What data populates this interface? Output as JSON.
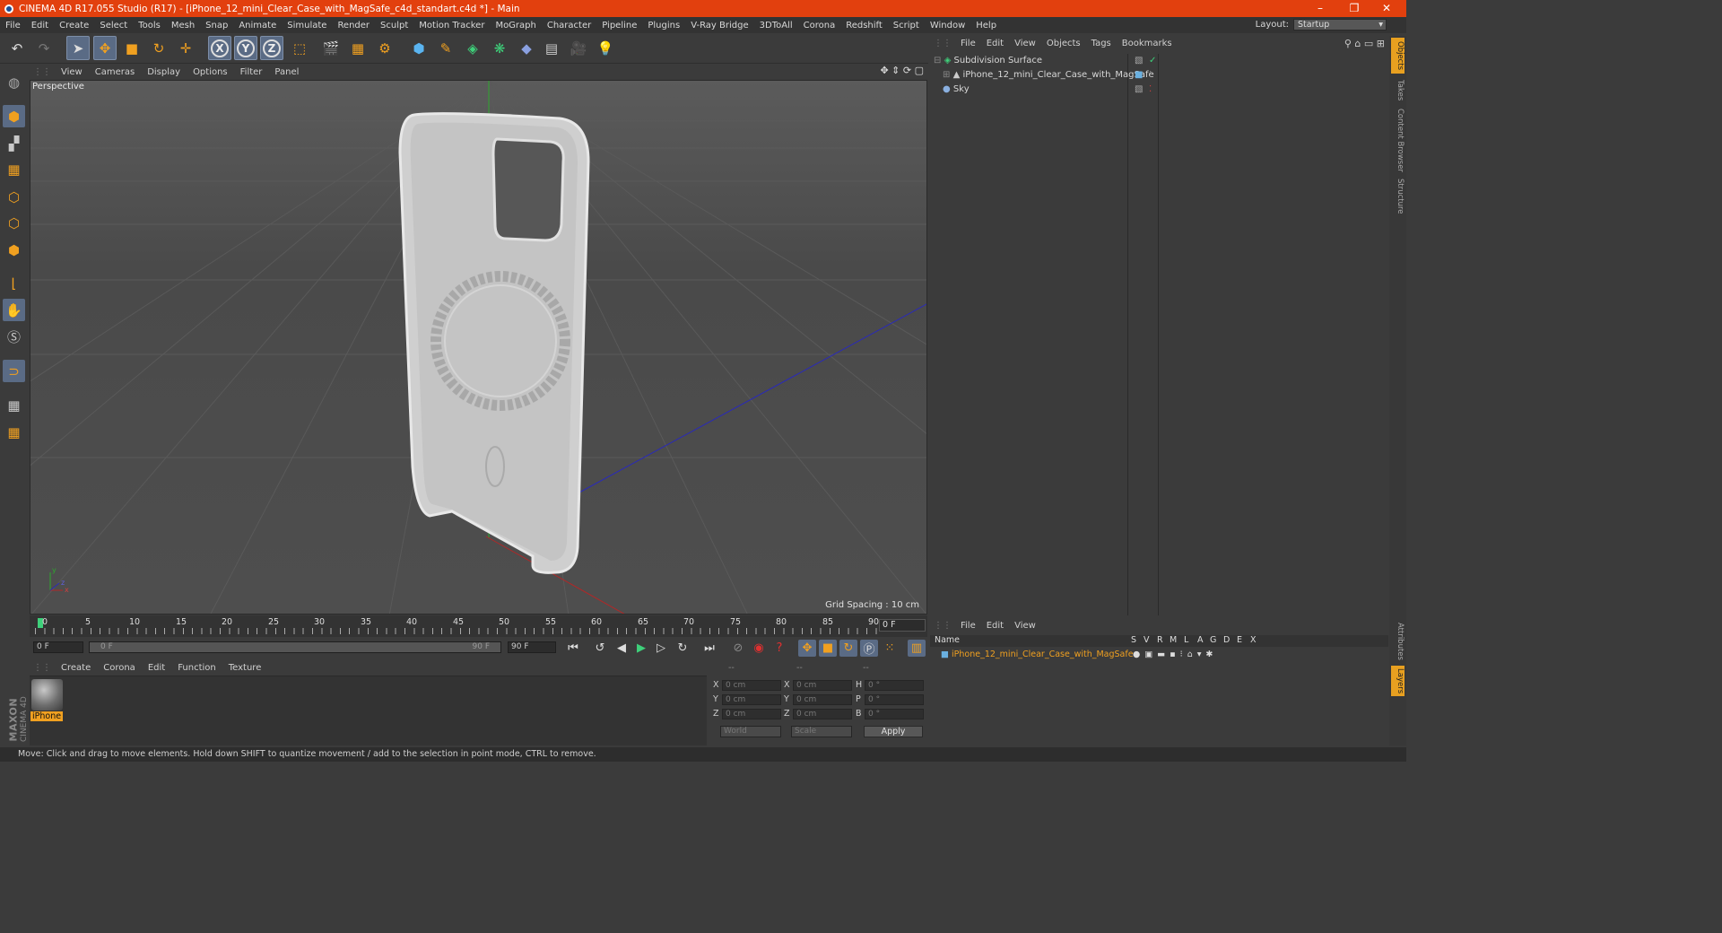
{
  "window": {
    "title": "CINEMA 4D R17.055 Studio (R17) - [iPhone_12_mini_Clear_Case_with_MagSafe_c4d_standart.c4d *] - Main",
    "controls": [
      "–",
      "❐",
      "✕"
    ]
  },
  "menubar": {
    "items": [
      "File",
      "Edit",
      "Create",
      "Select",
      "Tools",
      "Mesh",
      "Snap",
      "Animate",
      "Simulate",
      "Render",
      "Sculpt",
      "Motion Tracker",
      "MoGraph",
      "Character",
      "Pipeline",
      "Plugins",
      "V-Ray Bridge",
      "3DToAll",
      "Corona",
      "Redshift",
      "Script",
      "Window",
      "Help"
    ],
    "layout_label": "Layout:",
    "layout_value": "Startup"
  },
  "toolbar": {
    "axis_labels": [
      "X",
      "Y",
      "Z"
    ]
  },
  "viewport": {
    "menu": [
      "View",
      "Cameras",
      "Display",
      "Options",
      "Filter",
      "Panel"
    ],
    "camera_label": "Perspective",
    "grid_spacing": "Grid Spacing : 10 cm",
    "axis_labels": {
      "y": "y",
      "x": "x",
      "z": "z"
    }
  },
  "timeline": {
    "ticks": [
      "0",
      "5",
      "10",
      "15",
      "20",
      "25",
      "30",
      "35",
      "40",
      "45",
      "50",
      "55",
      "60",
      "65",
      "70",
      "75",
      "80",
      "85",
      "90"
    ],
    "current_frame": "0 F",
    "start_field": "0 F",
    "range_start": "0 F",
    "range_end": "90 F",
    "end_field": "90 F"
  },
  "materials": {
    "menu": [
      "Create",
      "Corona",
      "Edit",
      "Function",
      "Texture"
    ],
    "items": [
      {
        "name": "iPhone"
      }
    ]
  },
  "attributes": {
    "header": [
      "--",
      "--",
      "--"
    ],
    "rows": [
      {
        "a": "X",
        "av": "0 cm",
        "b": "X",
        "bv": "0 cm",
        "c": "H",
        "cv": "0 °"
      },
      {
        "a": "Y",
        "av": "0 cm",
        "b": "Y",
        "bv": "0 cm",
        "c": "P",
        "cv": "0 °"
      },
      {
        "a": "Z",
        "av": "0 cm",
        "b": "Z",
        "bv": "0 cm",
        "c": "B",
        "cv": "0 °"
      }
    ],
    "coord_mode": "World",
    "size_mode": "Scale",
    "apply_label": "Apply"
  },
  "objects": {
    "menu": [
      "File",
      "Edit",
      "View",
      "Objects",
      "Tags",
      "Bookmarks"
    ],
    "items": [
      {
        "name": "Subdivision Surface",
        "indent": 0
      },
      {
        "name": "iPhone_12_mini_Clear_Case_with_MagSafe",
        "indent": 1
      },
      {
        "name": "Sky",
        "indent": 0
      }
    ]
  },
  "layers": {
    "menu": [
      "File",
      "Edit",
      "View"
    ],
    "columns": [
      "Name",
      "S",
      "V",
      "R",
      "M",
      "L",
      "A",
      "G",
      "D",
      "E",
      "X"
    ],
    "items": [
      {
        "name": "iPhone_12_mini_Clear_Case_with_MagSafe",
        "color": "#6ab0e0"
      }
    ]
  },
  "side_tabs": [
    "Objects",
    "Takes",
    "Content Browser",
    "Structure",
    "Attributes",
    "Layers"
  ],
  "status": "Move: Click and drag to move elements. Hold down SHIFT to quantize movement / add to the selection in point mode, CTRL to remove.",
  "brand": {
    "maxon": "MAXON",
    "cinema": "CINEMA 4D"
  },
  "colors": {
    "title_bar": "#e2400e",
    "selection": "#5a6b85",
    "accent_orange": "#f0a020"
  }
}
